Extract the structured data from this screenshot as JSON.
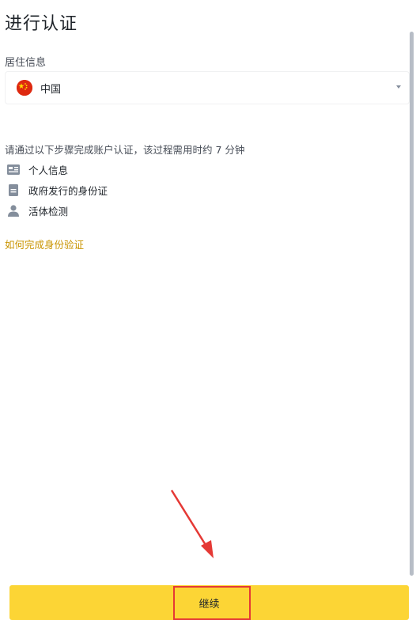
{
  "page": {
    "title": "进行认证"
  },
  "residence": {
    "label": "居住信息",
    "selected_country": "中国",
    "flag_icon": "china-flag-icon"
  },
  "steps": {
    "intro": "请通过以下步骤完成账户认证，该过程需用时约 7 分钟",
    "items": [
      {
        "label": "个人信息",
        "icon": "id-card-icon"
      },
      {
        "label": "政府发行的身份证",
        "icon": "document-icon"
      },
      {
        "label": "活体检测",
        "icon": "person-icon"
      }
    ]
  },
  "help_link": "如何完成身份验证",
  "continue_button": "继续",
  "colors": {
    "accent": "#fcd535",
    "link": "#c99400",
    "annotation": "#e53935",
    "text_primary": "#1e2329",
    "text_secondary": "#474d57"
  }
}
